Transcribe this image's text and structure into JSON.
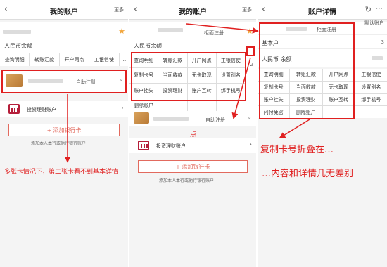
{
  "panel1": {
    "header": {
      "back": "‹",
      "title": "我的账户",
      "more": "更多"
    },
    "balance_label": "人民币余额",
    "actions": [
      "查询明细",
      "转账汇款",
      "开户网点",
      "工银信使"
    ],
    "actions_more": "…",
    "card_status": "自助注册",
    "finance_account": "投资理财账户",
    "add_card": "添加银行卡",
    "add_card_hint": "添加本人本行或他行银行账户",
    "annotation": "多张卡情况下，第二张卡看不到基本详情"
  },
  "panel2": {
    "header": {
      "back": "‹",
      "title": "我的账户",
      "more": "更多"
    },
    "card_status_top": "柜面注册",
    "balance_label": "人民币余额",
    "side_num": "2",
    "actions": [
      "查询明细",
      "转账汇款",
      "开户网点",
      "工银信使",
      "复制卡号",
      "当面收款",
      "无卡取现",
      "设置别名",
      "账户挂失",
      "投资理财",
      "账户互转",
      "绑手机号",
      "删除账户"
    ],
    "card_status": "自助注册",
    "note_dot": "点",
    "finance_account": "投资理财账户",
    "add_card": "添加银行卡",
    "add_card_hint": "添加本人本行或他行银行账户"
  },
  "panel3": {
    "header": {
      "back": "‹",
      "title": "账户详情"
    },
    "card_status": "柜面注册",
    "default_account": "默认账户",
    "side_num": "3",
    "basic_account": "基本户",
    "balance_label": "人民币 余额",
    "actions": [
      "查询明细",
      "转账汇款",
      "开户网点",
      "工银信使",
      "复制卡号",
      "当面收款",
      "无卡取现",
      "设置别名",
      "账户挂失",
      "投资理财",
      "账户互转",
      "绑手机号",
      "闪付免密",
      "删除账户"
    ]
  },
  "annotations": {
    "copy_folded": "复制卡号折叠在…",
    "same_content": "…内容和详情几无差别"
  },
  "colors": {
    "annotation_red": "#e02020",
    "star": "#f2a53a",
    "add_button": "#e26a5e"
  }
}
